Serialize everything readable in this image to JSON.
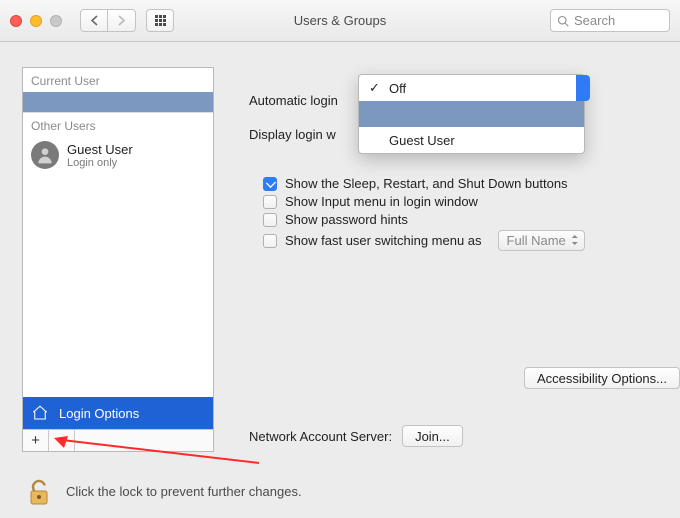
{
  "window": {
    "title": "Users & Groups",
    "search_placeholder": "Search"
  },
  "sidebar": {
    "current_header": "Current User",
    "other_header": "Other Users",
    "other_users": [
      {
        "name": "Guest User",
        "sub": "Login only"
      }
    ],
    "login_options_label": "Login Options",
    "add_label": "+",
    "remove_label": "−"
  },
  "panel": {
    "automatic_login_label": "Automatic login",
    "display_login_label": "Display login w",
    "chk_sleep": "Show the Sleep, Restart, and Shut Down buttons",
    "chk_input": "Show Input menu in login window",
    "chk_hints": "Show password hints",
    "chk_fast": "Show fast user switching menu as",
    "fast_select": "Full Name",
    "accessibility_btn": "Accessibility Options...",
    "nas_label": "Network Account Server:",
    "join_btn": "Join..."
  },
  "dropdown": {
    "options": [
      "Off",
      "",
      "Guest User"
    ],
    "checked_index": 0,
    "highlight_index": 1
  },
  "lock": {
    "text": "Click the lock to prevent further changes."
  }
}
